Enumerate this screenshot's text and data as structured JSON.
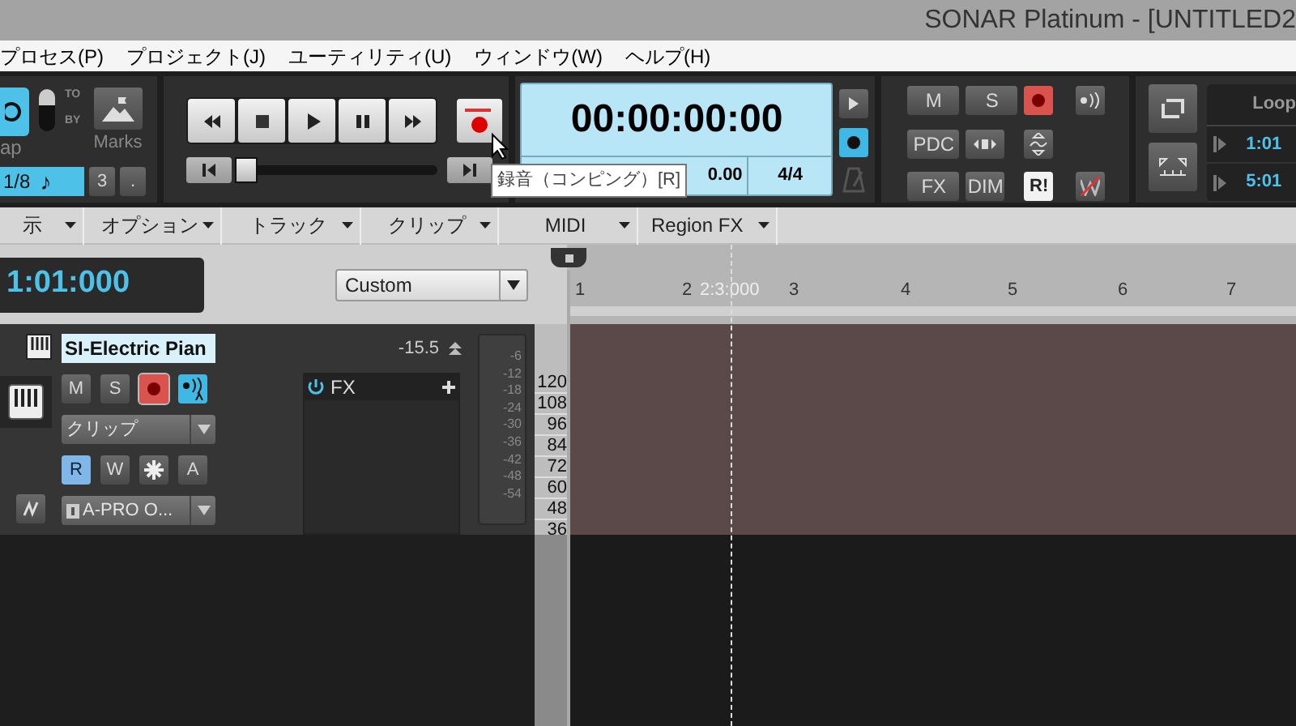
{
  "window": {
    "title": "SONAR Platinum - [UNTITLED2"
  },
  "menu": [
    "プロセス(P)",
    "プロジェクト(J)",
    "ユーティリティ(U)",
    "ウィンドウ(W)",
    "ヘルプ(H)"
  ],
  "snap": {
    "label": "ap",
    "on": true,
    "by_on": false,
    "to": "TO",
    "by": "BY",
    "marks": "Marks",
    "resolution": "1/8",
    "note": "♪",
    "triplet": "3",
    "dot": "."
  },
  "transport": {
    "level": 0,
    "tooltip": "録音（コンピング）[R]"
  },
  "time": {
    "value": "00:00:00:00",
    "tempo": "0.00",
    "meter": "4/4",
    "record_on": true
  },
  "mix": {
    "mute": "M",
    "solo": "S",
    "pdc": "PDC",
    "fx": "FX",
    "dim": "DIM",
    "reset": "R!",
    "record_on": true
  },
  "loop": {
    "title": "Loop",
    "start": "1:01",
    "end": "5:01"
  },
  "view_menus": [
    "示",
    "オプション",
    "トラック",
    "クリップ",
    "MIDI",
    "Region FX"
  ],
  "now_time": "1:01:000",
  "preset": "Custom",
  "ruler": {
    "marks": [
      "1",
      "2",
      "3",
      "4",
      "5",
      "6",
      "7"
    ],
    "cursor_label": "2:3:000"
  },
  "track": {
    "name": "SI-Electric Pian",
    "volume": "-15.5",
    "buttons": [
      {
        "label": "M",
        "on": false
      },
      {
        "label": "S",
        "on": false
      }
    ],
    "armed": true,
    "echo": true,
    "input": "クリップ",
    "automation": [
      {
        "label": "R",
        "on": true
      },
      {
        "label": "W",
        "on": false
      },
      {
        "label": "A",
        "on": false
      }
    ],
    "output": "A-PRO O...",
    "fx": "FX",
    "meter_scale": [
      "-6",
      "-12",
      "-18",
      "-24",
      "-30",
      "-36",
      "-42",
      "-48",
      "-54"
    ]
  },
  "pitches": [
    "120",
    "108",
    "96",
    "84",
    "72",
    "60",
    "48",
    "36"
  ]
}
